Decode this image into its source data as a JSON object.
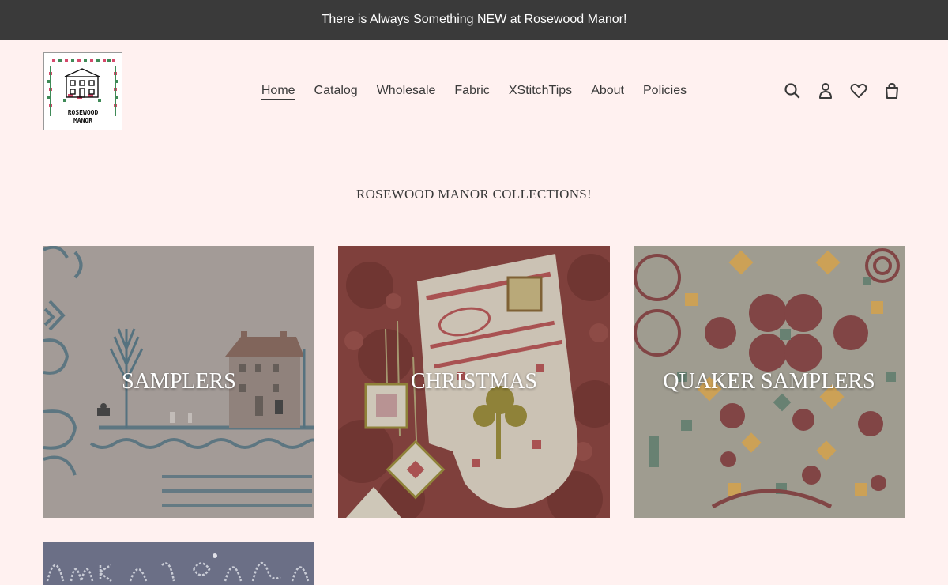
{
  "announcement": "There is Always Something NEW at Rosewood Manor!",
  "logo": {
    "line1": "ROSEWOOD",
    "line2": "MANOR"
  },
  "nav": [
    {
      "label": "Home",
      "active": true
    },
    {
      "label": "Catalog"
    },
    {
      "label": "Wholesale"
    },
    {
      "label": "Fabric"
    },
    {
      "label": "XStitchTips"
    },
    {
      "label": "About"
    },
    {
      "label": "Policies"
    }
  ],
  "header_icons": [
    "search-icon",
    "account-icon",
    "heart-icon",
    "cart-icon"
  ],
  "collections_heading": "ROSEWOOD MANOR COLLECTIONS!",
  "collections": [
    {
      "title": "SAMPLERS"
    },
    {
      "title": "CHRISTMAS"
    },
    {
      "title": "QUAKER SAMPLERS"
    },
    {
      "title": ""
    }
  ],
  "colors": {
    "announcement_bg": "#3a3a3a",
    "page_bg": "#fff1f0",
    "text": "#3a3a3a"
  }
}
